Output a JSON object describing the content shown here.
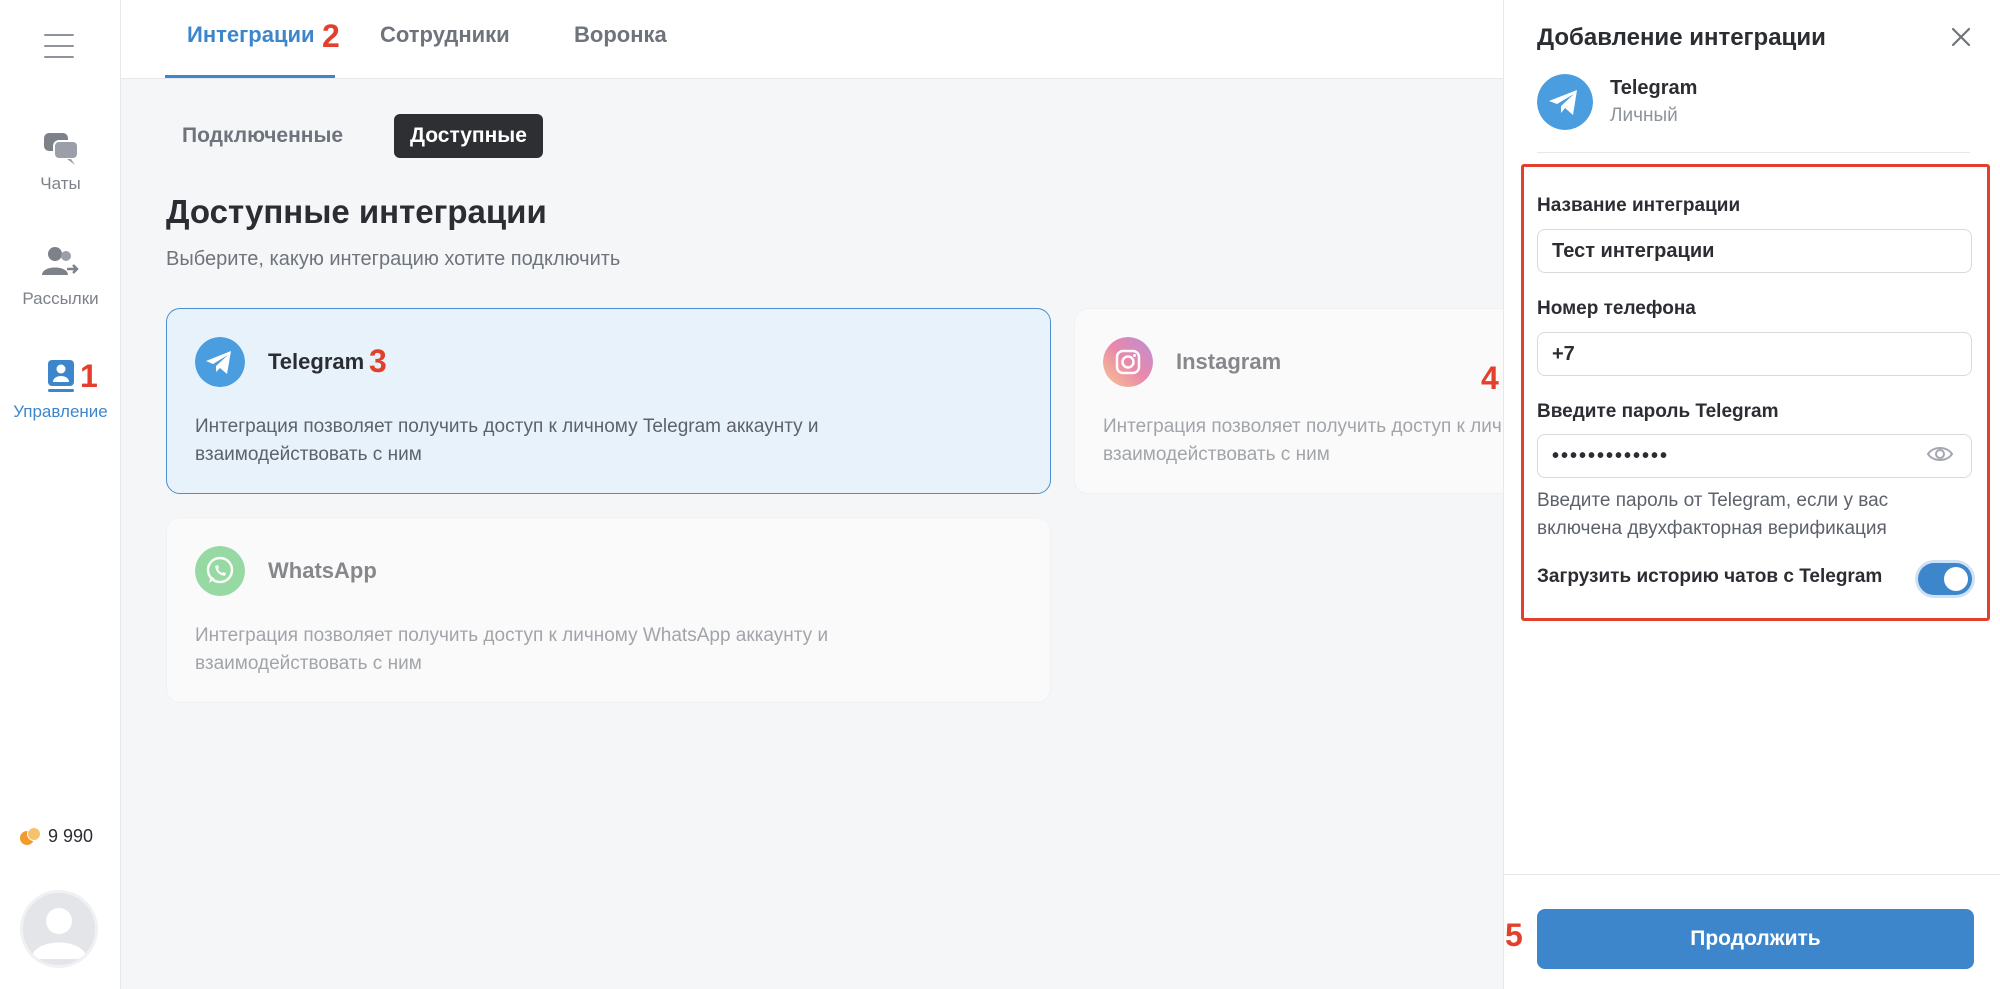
{
  "sidebar": {
    "items": [
      {
        "label": "Чаты",
        "icon": "chats-icon"
      },
      {
        "label": "Рассылки",
        "icon": "mailing-icon"
      },
      {
        "label": "Управление",
        "icon": "management-icon",
        "active": true
      }
    ],
    "balance": "9 990"
  },
  "topbar": {
    "tabs": [
      {
        "label": "Интеграции",
        "active": true
      },
      {
        "label": "Сотрудники"
      },
      {
        "label": "Воронка"
      }
    ]
  },
  "main": {
    "subtabs": [
      {
        "label": "Подключенные"
      },
      {
        "label": "Доступные",
        "active": true
      }
    ],
    "title": "Доступные интеграции",
    "subtitle": "Выберите, какую интеграцию хотите подключить",
    "cards": [
      {
        "title": "Telegram",
        "description": "Интеграция позволяет получить доступ к личному Telegram аккаунту и взаимодействовать с ним",
        "icon": "telegram-icon",
        "selected": true
      },
      {
        "title": "Instagram",
        "description": "Интеграция позволяет получить доступ к личному Instagram аккаунту и взаимодействовать с ним",
        "icon": "instagram-icon"
      },
      {
        "title": "WhatsApp",
        "description": "Интеграция позволяет получить доступ к личному WhatsApp аккаунту и взаимодействовать с ним",
        "icon": "whatsapp-icon"
      }
    ]
  },
  "panel": {
    "title": "Добавление интеграции",
    "app_name": "Telegram",
    "app_type": "Личный",
    "fields": {
      "name_label": "Название интеграции",
      "name_value": "Тест интеграции",
      "phone_label": "Номер телефона",
      "phone_value": "+7",
      "password_label": "Введите пароль Telegram",
      "password_value": "•••••••••••••",
      "password_hint": "Введите пароль от Telegram, если у вас включена двухфакторная верификация",
      "history_label": "Загрузить историю чатов с Telegram",
      "history_enabled": true
    },
    "continue_label": "Продолжить"
  },
  "annotations": [
    "1",
    "2",
    "3",
    "4",
    "5"
  ],
  "colors": {
    "accent": "#3e86cc",
    "marker": "#e2402d",
    "selected_card_bg": "#e8f2fb",
    "dark_chip": "#2d2f33"
  }
}
